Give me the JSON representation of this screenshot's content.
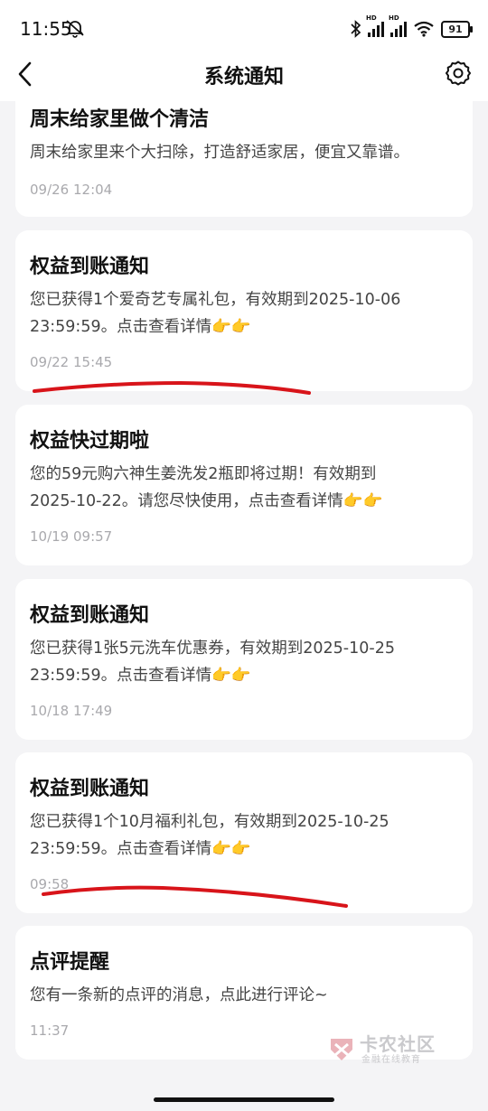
{
  "status": {
    "time": "11:55",
    "hd1": "HD",
    "hd2": "HD",
    "battery": "91"
  },
  "nav": {
    "title": "系统通知"
  },
  "notifications": [
    {
      "title": "周末给家里做个清洁",
      "body": "周末给家里来个大扫除，打造舒适家居，便宜又靠谱。",
      "time": "09/26 12:04"
    },
    {
      "title": "权益到账通知",
      "body_line1": "您已获得1个爱奇艺专属礼包，有效期到2025-10-06",
      "body_line2": "23:59:59。点击查看详情👉👉",
      "time": "09/22 15:45"
    },
    {
      "title": "权益快过期啦",
      "body_line1": "您的59元购六神生姜洗发2瓶即将过期！有效期到",
      "body_line2": "2025-10-22。请您尽快使用，点击查看详情👉👉",
      "time": "10/19 09:57"
    },
    {
      "title": "权益到账通知",
      "body_line1": "您已获得1张5元洗车优惠券，有效期到2025-10-25",
      "body_line2": "23:59:59。点击查看详情👉👉",
      "time": "10/18 17:49"
    },
    {
      "title": "权益到账通知",
      "body_line1": "您已获得1个10月福利礼包，有效期到2025-10-25",
      "body_line2": "23:59:59。点击查看详情👉👉",
      "time": "09:58"
    },
    {
      "title": "点评提醒",
      "body": "您有一条新的点评的消息，点此进行评论~",
      "time": "11:37"
    }
  ],
  "watermark": {
    "name": "卡农社区",
    "sub": "金融在线教育"
  },
  "colors": {
    "background": "#f4f4f6",
    "card": "#ffffff",
    "annotation_red": "#d8141a"
  }
}
